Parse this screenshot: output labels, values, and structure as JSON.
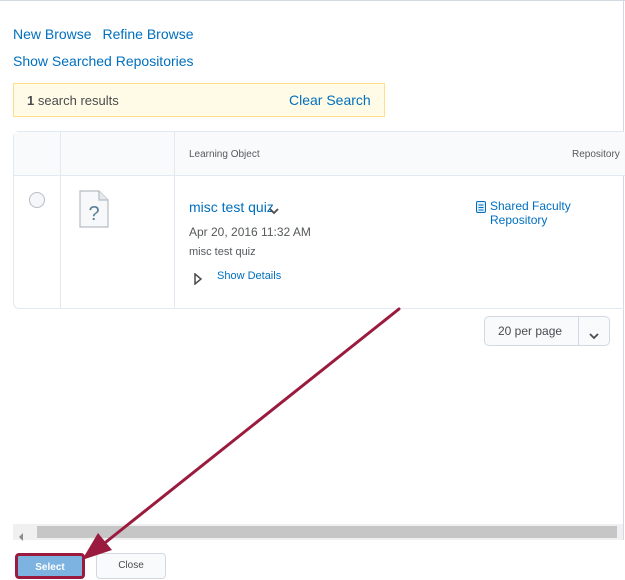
{
  "nav": {
    "new_browse": "New Browse",
    "refine_browse": "Refine Browse",
    "show_searched_repositories": "Show Searched Repositories"
  },
  "results": {
    "count": "1",
    "count_suffix": " search results",
    "clear_search": "Clear Search"
  },
  "table": {
    "headers": {
      "learning_object": "Learning Object",
      "repository": "Repository"
    },
    "rows": [
      {
        "title": "misc test quiz",
        "date": "Apr 20, 2016 11:32 AM",
        "description": "misc test quiz",
        "show_details": "Show Details",
        "repository": "Shared Faculty Repository",
        "thumbnail_icon": "unknown-file-icon"
      }
    ]
  },
  "pagination": {
    "per_page": "20 per page"
  },
  "footer": {
    "select_label": "Select",
    "close_label": "Close"
  },
  "colors": {
    "link": "#006fbf",
    "results_bg": "#fffbe6",
    "annotation_arrow": "#9b1b3f",
    "select_button": "#7cb3e0"
  }
}
